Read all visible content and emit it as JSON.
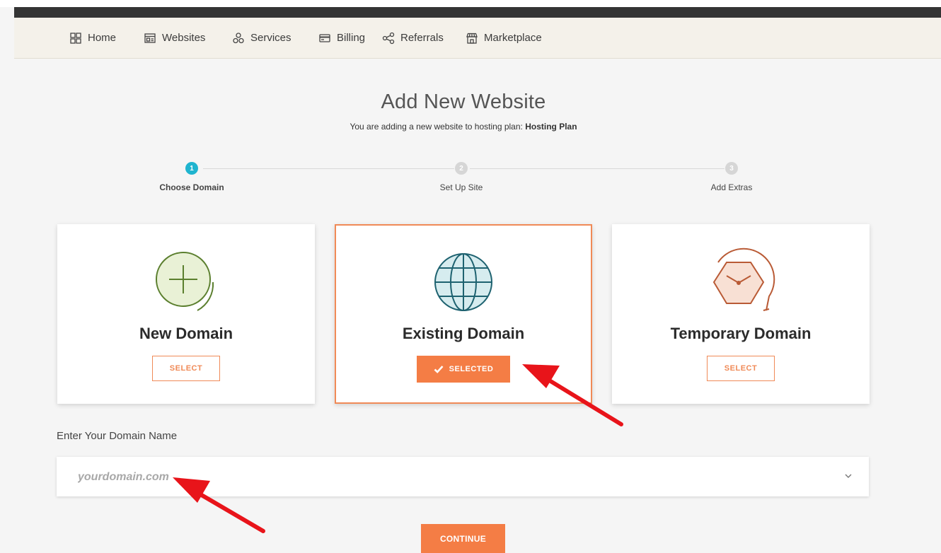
{
  "nav": {
    "items": [
      {
        "label": "Home",
        "icon": "grid-icon"
      },
      {
        "label": "Websites",
        "icon": "window-icon"
      },
      {
        "label": "Services",
        "icon": "services-icon"
      },
      {
        "label": "Billing",
        "icon": "card-icon"
      },
      {
        "label": "Referrals",
        "icon": "share-icon"
      },
      {
        "label": "Marketplace",
        "icon": "store-icon"
      }
    ]
  },
  "page": {
    "title": "Add New Website",
    "subtitle_prefix": "You are adding a new website to hosting plan:",
    "plan_name": "Hosting Plan"
  },
  "steps": [
    {
      "number": "1",
      "label": "Choose Domain",
      "active": true
    },
    {
      "number": "2",
      "label": "Set Up Site",
      "active": false
    },
    {
      "number": "3",
      "label": "Add Extras",
      "active": false
    }
  ],
  "options": [
    {
      "title": "New Domain",
      "button": "SELECT",
      "selected": false,
      "icon": "plus-circle-icon"
    },
    {
      "title": "Existing Domain",
      "button": "SELECTED",
      "selected": true,
      "icon": "globe-icon"
    },
    {
      "title": "Temporary Domain",
      "button": "SELECT",
      "selected": false,
      "icon": "clock-hexagon-icon"
    }
  ],
  "domain_field": {
    "label": "Enter Your Domain Name",
    "placeholder": "yourdomain.com",
    "value": ""
  },
  "continue_label": "CONTINUE",
  "colors": {
    "accent": "#f47d45",
    "step_active": "#1fb4cf",
    "step_inactive": "#d6d6d6",
    "annotation_arrow": "#e8141a"
  }
}
